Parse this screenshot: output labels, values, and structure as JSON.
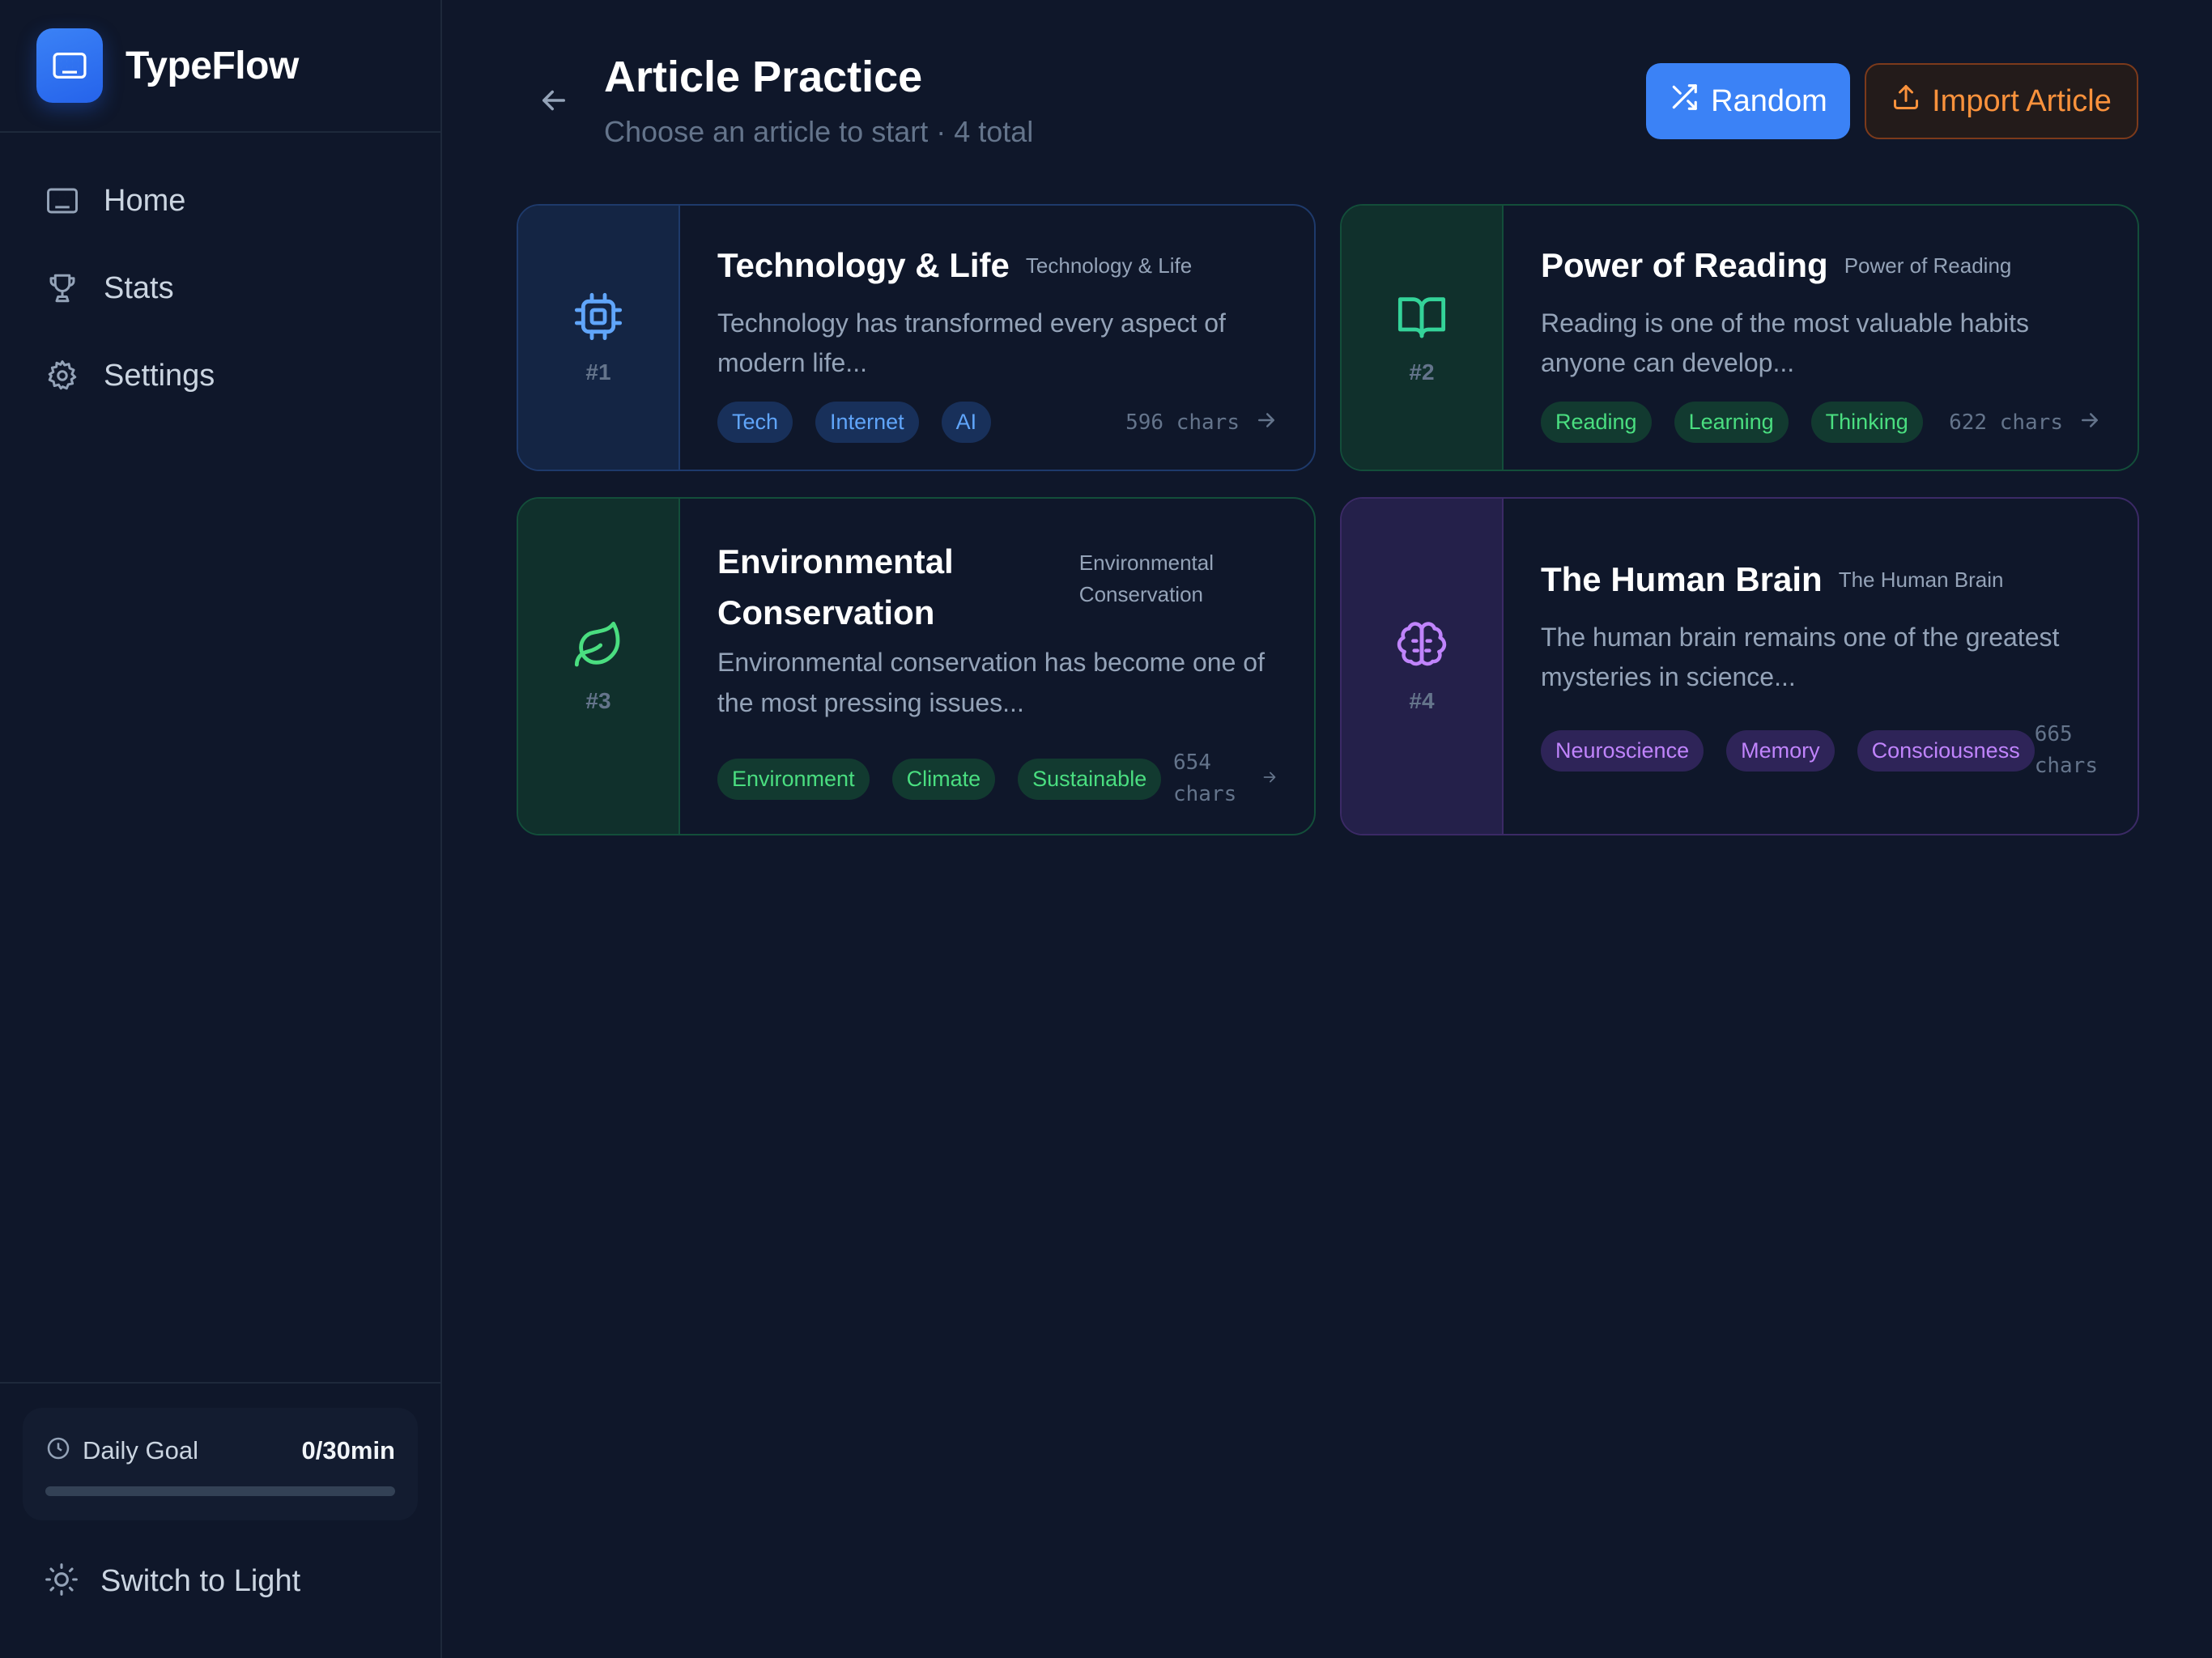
{
  "app": {
    "name": "TypeFlow"
  },
  "nav": [
    {
      "label": "Home",
      "icon": "keyboard-icon"
    },
    {
      "label": "Stats",
      "icon": "trophy-icon"
    },
    {
      "label": "Settings",
      "icon": "gear-icon"
    }
  ],
  "goal": {
    "label": "Daily Goal",
    "value": "0/30min",
    "progress_percent": 0
  },
  "theme_toggle": {
    "label": "Switch to Light"
  },
  "header": {
    "title": "Article Practice",
    "subtitle": "Choose an article to start · 4 total",
    "random_label": "Random",
    "import_label": "Import Article"
  },
  "articles": [
    {
      "number": "#1",
      "title": "Technology & Life",
      "subtag": "Technology & Life",
      "description": "Technology has transformed every aspect of modern life...",
      "tags": [
        "Tech",
        "Internet",
        "AI"
      ],
      "chars": "596 chars",
      "icon": "cpu-icon",
      "accent": "#60a5fa"
    },
    {
      "number": "#2",
      "title": "Power of Reading",
      "subtag": "Power of Reading",
      "description": "Reading is one of the most valuable habits anyone can develop...",
      "tags": [
        "Reading",
        "Learning",
        "Thinking"
      ],
      "chars": "622 chars",
      "icon": "book-open-icon",
      "accent": "#34d399"
    },
    {
      "number": "#3",
      "title": "Environmental Conservation",
      "title_line1": "Environmental",
      "title_line2": "Conservation",
      "subtag": "Environmental Conservation",
      "subtag_line1": "Environmental",
      "subtag_line2": "Conservation",
      "description": "Environmental conservation has become one of the most pressing issues...",
      "tags": [
        "Environment",
        "Climate",
        "Sustainable"
      ],
      "chars": "654 chars",
      "chars_line1": "654",
      "chars_line2": "chars",
      "icon": "leaf-icon",
      "accent": "#4ade80"
    },
    {
      "number": "#4",
      "title": "The Human Brain",
      "subtag": "The Human Brain",
      "description": "The human brain remains one of the greatest mysteries in science...",
      "tags": [
        "Neuroscience",
        "Memory",
        "Consciousness"
      ],
      "chars": "665 chars",
      "chars_line1": "665",
      "chars_line2": "chars",
      "icon": "brain-icon",
      "accent": "#c084fc"
    }
  ]
}
